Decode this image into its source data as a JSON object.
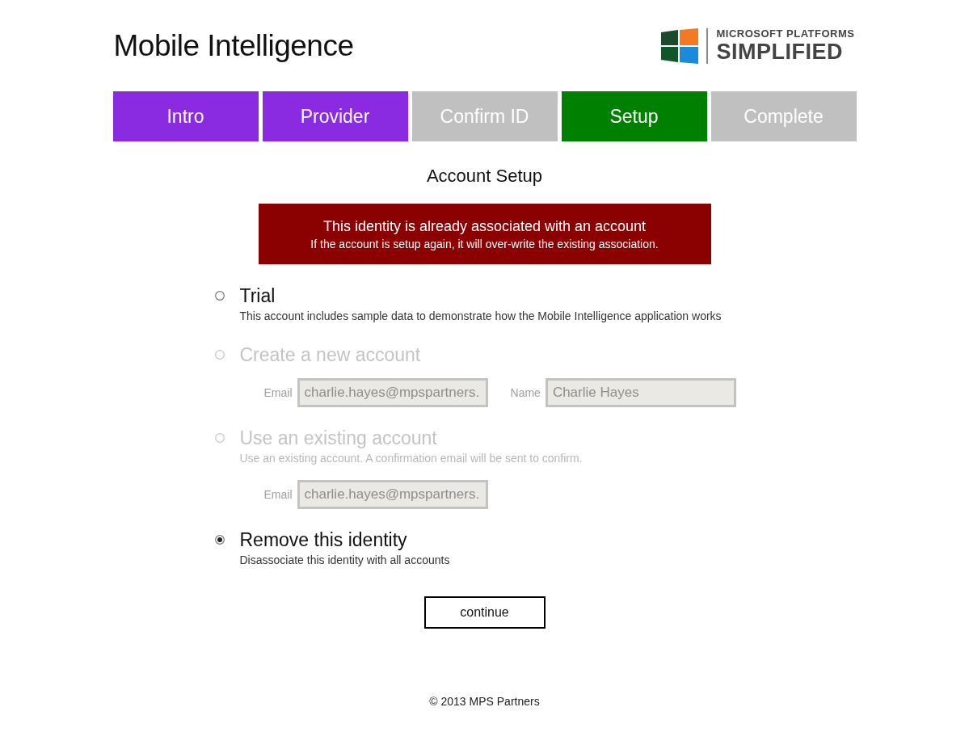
{
  "header": {
    "title": "Mobile Intelligence",
    "logo": {
      "line_1": "MICROSOFT PLATFORMS",
      "line_2": "SIMPLIFIED"
    }
  },
  "steps": [
    {
      "label": "Intro",
      "completed": true,
      "selected": false
    },
    {
      "label": "Provider",
      "completed": true,
      "selected": false
    },
    {
      "label": "Confirm ID",
      "completed": false,
      "selected": false
    },
    {
      "label": "Setup",
      "completed": false,
      "selected": true
    },
    {
      "label": "Complete",
      "completed": false,
      "selected": false
    }
  ],
  "heading": "Account Setup",
  "alert": {
    "title": "This identity is already associated with an account",
    "message": "If the account is setup again, it will over-write the existing association."
  },
  "options": [
    {
      "title": "Trial",
      "description": "This account includes sample data to demonstrate how the Mobile Intelligence application works",
      "selected": false,
      "disabled": false
    },
    {
      "title": "Create a new account",
      "selected": false,
      "disabled": true,
      "fields": [
        {
          "label": "Email",
          "value": "charlie.hayes@mpspartners."
        },
        {
          "label": "Name",
          "value": "Charlie Hayes"
        }
      ]
    },
    {
      "title": "Use an existing account",
      "description": "Use an existing account. A confirmation email will be sent to confirm.",
      "selected": false,
      "disabled": true,
      "fields": [
        {
          "label": "Email",
          "value": "charlie.hayes@mpspartners."
        }
      ]
    },
    {
      "title": "Remove this identity",
      "description": "Disassociate this identity with all accounts",
      "selected": true,
      "disabled": false
    }
  ],
  "continue_button": "continue",
  "footer": "© 2013 MPS Partners"
}
